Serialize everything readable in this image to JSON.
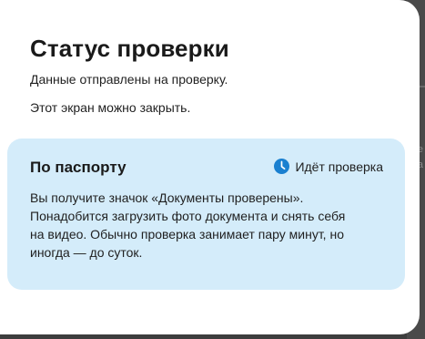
{
  "modal": {
    "title": "Статус проверки",
    "line1": "Данные отправлены на проверку.",
    "line2": "Этот экран можно закрыть."
  },
  "card": {
    "title": "По паспорту",
    "status_icon": "clock-icon",
    "status_label": "Идёт проверка",
    "text_line1": "Вы получите значок «Документы проверены».",
    "text_line2": "Понадобится загрузить фото документа и снять себя",
    "text_line3": "на видео. Обычно проверка занимает пару минут, но",
    "text_line4": "иногда — до суток."
  },
  "colors": {
    "overlay": "#3d3d3d",
    "modal_bg": "#ffffff",
    "card_bg": "#d4ecfa",
    "status_icon": "#1a80d0",
    "text": "#1f1f1f"
  }
}
